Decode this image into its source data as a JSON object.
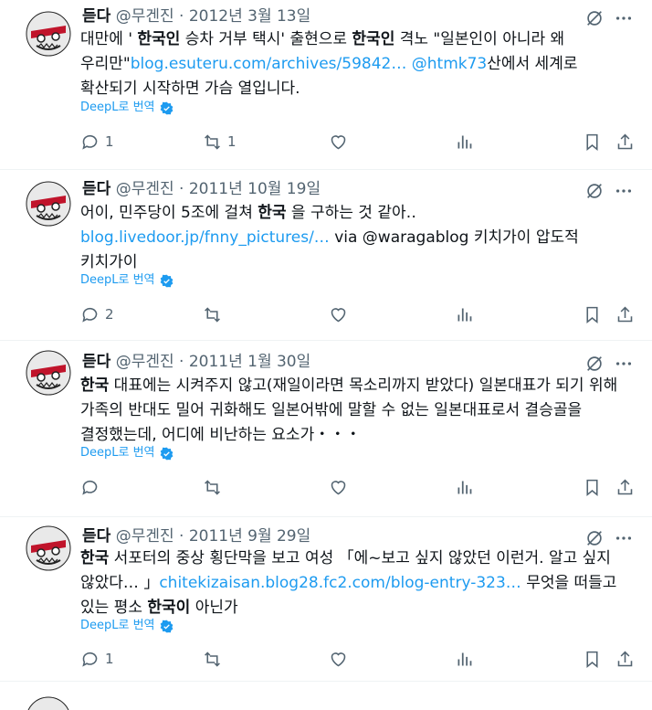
{
  "tweets": [
    {
      "name": "듣다",
      "handle": "@무겐진",
      "dot": "·",
      "date": "2012년 3월 13일",
      "body": [
        {
          "t": "대만에 ' "
        },
        {
          "t": "한국인",
          "b": true
        },
        {
          "t": " 승차 거부 택시' 출현으로 "
        },
        {
          "t": "한국인",
          "b": true
        },
        {
          "t": " 격노 \"일본인이 아니라 왜 우리만\""
        },
        {
          "t": "blog.esuteru.com/archives/59842…",
          "link": true
        },
        {
          "t": " "
        },
        {
          "t": "@htmk73",
          "link": true
        },
        {
          "t": "산에서 세계로 확산되기 시작하면 가슴 열입니다."
        }
      ],
      "translate": "DeepL로 번역",
      "replies": "1",
      "retweets": "1"
    },
    {
      "name": "듣다",
      "handle": "@무겐진",
      "dot": "·",
      "date": "2011년 10월 19일",
      "body": [
        {
          "t": "어이, 민주당이 5조에 걸쳐 "
        },
        {
          "t": "한국",
          "b": true
        },
        {
          "t": " 을 구하는 것 같아‥"
        },
        {
          "t": "blog.livedoor.jp/fnny_pictures/…",
          "link": true
        },
        {
          "t": " via @waragablog 키치가이 압도적 키치가이"
        }
      ],
      "translate": "DeepL로 번역",
      "replies": "2",
      "retweets": ""
    },
    {
      "name": "듣다",
      "handle": "@무겐진",
      "dot": "·",
      "date": "2011년 1월 30일",
      "body": [
        {
          "t": "한국",
          "b": true
        },
        {
          "t": " 대표에는 시켜주지 않고(재일이라면 목소리까지 받았다) 일본대표가 되기 위해 가족의 반대도 밀어 귀화해도 일본어밖에 말할 수 없는 일본대표로서 결승골을 결정했는데, 어디에 비난하는 요소가・・・"
        }
      ],
      "translate": "DeepL로 번역",
      "replies": "",
      "retweets": ""
    },
    {
      "name": "듣다",
      "handle": "@무겐진",
      "dot": "·",
      "date": "2011년 9월 29일",
      "body": [
        {
          "t": "한국",
          "b": true
        },
        {
          "t": " 서포터의 중상 횡단막을 보고 여성 「에~보고 싶지 않았던 이런거. 알고 싶지 않았다… 」"
        },
        {
          "t": "chitekizaisan.blog28.fc2.com/blog-entry-323…",
          "link": true
        },
        {
          "t": "    무엇을 떠들고 있는 평소 "
        },
        {
          "t": "한국이",
          "b": true
        },
        {
          "t": " 아닌가"
        }
      ],
      "translate": "DeepL로 번역",
      "replies": "1",
      "retweets": ""
    }
  ],
  "icons": {
    "reply": "speech-bubble-icon",
    "retweet": "retweet-icon",
    "like": "heart-icon",
    "views": "bar-chart-icon",
    "bookmark": "bookmark-icon",
    "share": "share-icon",
    "grok": "grok-icon",
    "more": "more-dots-icon",
    "translate_badge": "verified-badge-icon"
  },
  "colors": {
    "text": "#0f1419",
    "secondary": "#536471",
    "link": "#1d9bf0",
    "divider": "#eff3f4"
  }
}
